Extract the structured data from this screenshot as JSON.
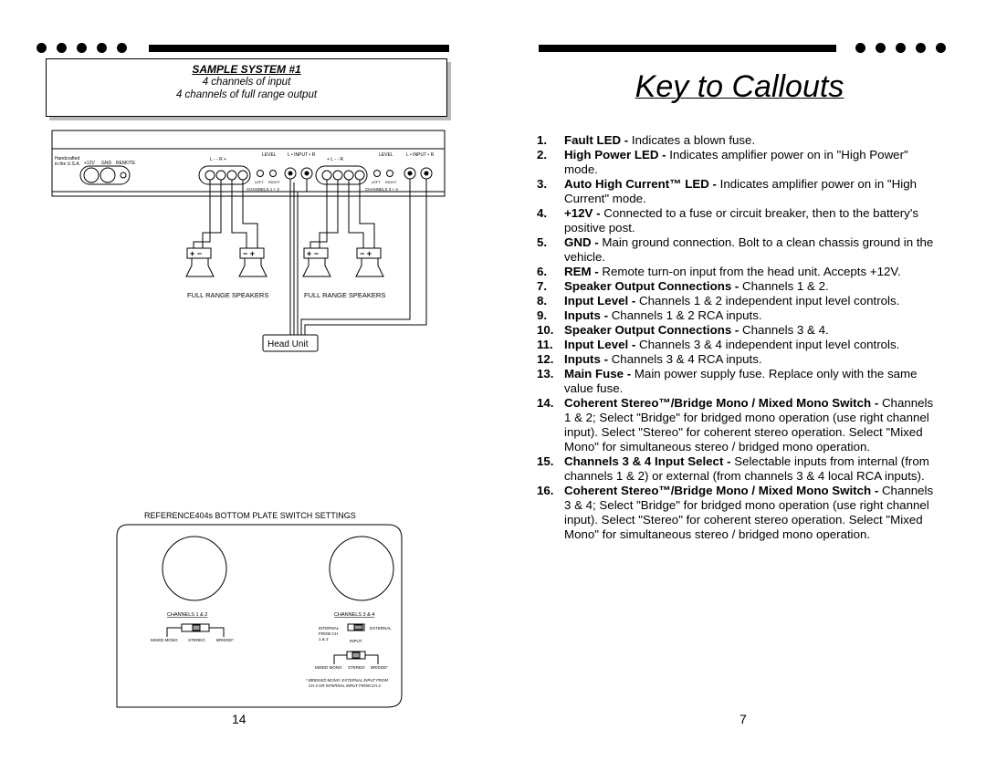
{
  "left_page": {
    "sample_box": {
      "title": "SAMPLE SYSTEM #1",
      "line1": "4 channels of input",
      "line2": "4 channels of full range output"
    },
    "amp_panel": {
      "made_in": "Handcrafted",
      "made_in2": "in the U.S.A.",
      "terminals": [
        "+12V",
        "GND",
        "REMOTE"
      ],
      "level_label": "LEVEL",
      "input_label": "L • INPUT • R",
      "speaker_label_1": "L -   - R +",
      "speaker_label_2": "+ L -   - R",
      "ch12": "CHANNELS 1 + 2",
      "ch34": "CHANNELS 3 + 4",
      "knob_left": "LEFT",
      "knob_right": "RIGHT"
    },
    "speaker_polarity": [
      "+ −",
      "− +",
      "+ −",
      "− +"
    ],
    "speaker_group_labels": [
      "FULL RANGE SPEAKERS",
      "FULL RANGE SPEAKERS"
    ],
    "head_unit": "Head Unit",
    "bottom_plate": {
      "title": "REFERENCE404s BOTTOM PLATE SWITCH SETTINGS",
      "ch12_title": "CHANNELS 1 & 2",
      "ch34_title": "CHANNELS 3 & 4",
      "mode_labels": [
        "MIXED MONO",
        "STEREO",
        "BRIDGE*"
      ],
      "input_internal": [
        "INTERNAL",
        "FROM CH",
        "1 & 2"
      ],
      "input_external": "EXTERNAL",
      "input_label": "INPUT",
      "footnote1": "* BRIDGED MONO: EXTERNAL INPUT FROM",
      "footnote2": "CH 4 OR INTERNAL INPUT FROM CH 2."
    },
    "page_number": "14"
  },
  "right_page": {
    "title": "Key to Callouts",
    "callouts": [
      {
        "n": "1.",
        "bold": "Fault LED - ",
        "text": "Indicates a blown fuse."
      },
      {
        "n": "2.",
        "bold": "High Power LED - ",
        "text": "Indicates amplifier power on in \"High Power\" mode."
      },
      {
        "n": "3.",
        "bold": "Auto High Current™ LED - ",
        "text": "Indicates amplifier power on in \"High Current\" mode."
      },
      {
        "n": "4.",
        "bold": "+12V - ",
        "text": "Connected to a fuse or circuit breaker, then to the battery's positive post."
      },
      {
        "n": "5.",
        "bold": "GND - ",
        "text": "Main ground connection.  Bolt to a clean chassis ground in the vehicle."
      },
      {
        "n": "6.",
        "bold": "REM - ",
        "text": "Remote turn-on input from the head unit.  Accepts +12V."
      },
      {
        "n": "7.",
        "bold": "Speaker Output Connections - ",
        "text": "Channels 1 & 2."
      },
      {
        "n": "8.",
        "bold": "Input Level - ",
        "text": " Channels 1 & 2 independent input level controls."
      },
      {
        "n": "9.",
        "bold": "Inputs - ",
        "text": "Channels 1 & 2 RCA inputs."
      },
      {
        "n": "10.",
        "bold": "Speaker Output Connections - ",
        "text": "Channels 3 & 4."
      },
      {
        "n": "11.",
        "bold": "Input Level - ",
        "text": "Channels 3 & 4 independent input level controls."
      },
      {
        "n": "12.",
        "bold": "Inputs - ",
        "text": "Channels 3 & 4 RCA inputs."
      },
      {
        "n": "13.",
        "bold": "Main Fuse - ",
        "text": "Main power supply fuse.  Replace only with the same value fuse."
      },
      {
        "n": "14.",
        "bold": "Coherent Stereo™/Bridge Mono / Mixed Mono Switch - ",
        "text": "Channels 1 & 2; Select \"Bridge\" for bridged mono operation (use right channel input).  Select \"Stereo\" for coherent stereo operation.  Select \"Mixed Mono\" for simultaneous stereo / bridged mono operation."
      },
      {
        "n": "15.",
        "bold": "Channels 3 & 4 Input Select - ",
        "text": "  Selectable inputs from internal (from channels 1 & 2) or external (from channels 3 & 4 local RCA inputs)."
      },
      {
        "n": "16.",
        "bold": "Coherent Stereo™/Bridge Mono / Mixed Mono Switch - ",
        "text": "Channels 3 & 4; Select \"Bridge\" for bridged mono operation (use right channel input).  Select \"Stereo\" for coherent stereo operation.  Select \"Mixed Mono\" for simultaneous stereo / bridged mono operation."
      }
    ],
    "page_number": "7"
  }
}
